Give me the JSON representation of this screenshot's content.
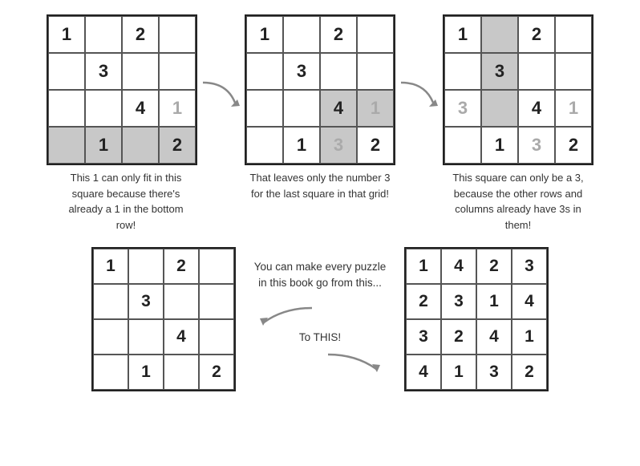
{
  "grids": {
    "top1": {
      "cells": [
        {
          "val": "1",
          "gray": false
        },
        {
          "val": "",
          "gray": false
        },
        {
          "val": "2",
          "gray": false
        },
        {
          "val": "",
          "gray": false
        },
        {
          "val": "",
          "gray": false
        },
        {
          "val": "3",
          "gray": false
        },
        {
          "val": "",
          "gray": false
        },
        {
          "val": "",
          "gray": false
        },
        {
          "val": "",
          "gray": false
        },
        {
          "val": "",
          "gray": false
        },
        {
          "val": "4",
          "gray": false
        },
        {
          "val": "1",
          "gray": false,
          "numgray": true
        },
        {
          "val": "",
          "gray": true
        },
        {
          "val": "1",
          "gray": true
        },
        {
          "val": "",
          "gray": true
        },
        {
          "val": "2",
          "gray": true
        }
      ]
    },
    "top2": {
      "cells": [
        {
          "val": "1",
          "gray": false
        },
        {
          "val": "",
          "gray": false
        },
        {
          "val": "2",
          "gray": false
        },
        {
          "val": "",
          "gray": false
        },
        {
          "val": "",
          "gray": false
        },
        {
          "val": "3",
          "gray": false
        },
        {
          "val": "",
          "gray": false
        },
        {
          "val": "",
          "gray": false
        },
        {
          "val": "",
          "gray": false
        },
        {
          "val": "",
          "gray": false
        },
        {
          "val": "4",
          "gray": true
        },
        {
          "val": "1",
          "gray": true,
          "numgray": true
        },
        {
          "val": "",
          "gray": false
        },
        {
          "val": "1",
          "gray": false
        },
        {
          "val": "3",
          "gray": true,
          "numgray": true
        },
        {
          "val": "2",
          "gray": false
        }
      ]
    },
    "top3": {
      "cells": [
        {
          "val": "1",
          "gray": false
        },
        {
          "val": "",
          "gray": true
        },
        {
          "val": "2",
          "gray": false
        },
        {
          "val": "",
          "gray": false
        },
        {
          "val": "",
          "gray": false
        },
        {
          "val": "3",
          "gray": true
        },
        {
          "val": "",
          "gray": false
        },
        {
          "val": "",
          "gray": false
        },
        {
          "val": "3",
          "gray": false,
          "numgray": true
        },
        {
          "val": "",
          "gray": true
        },
        {
          "val": "4",
          "gray": false
        },
        {
          "val": "1",
          "gray": false,
          "numgray": true
        },
        {
          "val": "",
          "gray": false
        },
        {
          "val": "1",
          "gray": false
        },
        {
          "val": "3",
          "gray": false,
          "numgray2": true
        },
        {
          "val": "2",
          "gray": false
        }
      ]
    },
    "bottom1": {
      "cells": [
        {
          "val": "1",
          "gray": false
        },
        {
          "val": "",
          "gray": false
        },
        {
          "val": "2",
          "gray": false
        },
        {
          "val": "",
          "gray": false
        },
        {
          "val": "",
          "gray": false
        },
        {
          "val": "3",
          "gray": false
        },
        {
          "val": "",
          "gray": false
        },
        {
          "val": "",
          "gray": false
        },
        {
          "val": "",
          "gray": false
        },
        {
          "val": "",
          "gray": false
        },
        {
          "val": "4",
          "gray": false
        },
        {
          "val": "",
          "gray": false
        },
        {
          "val": "",
          "gray": false
        },
        {
          "val": "1",
          "gray": false
        },
        {
          "val": "",
          "gray": false
        },
        {
          "val": "2",
          "gray": false
        }
      ]
    },
    "bottom2": {
      "cells": [
        {
          "val": "1",
          "gray": false
        },
        {
          "val": "4",
          "gray": false
        },
        {
          "val": "2",
          "gray": false
        },
        {
          "val": "3",
          "gray": false
        },
        {
          "val": "2",
          "gray": false
        },
        {
          "val": "3",
          "gray": false
        },
        {
          "val": "1",
          "gray": false
        },
        {
          "val": "4",
          "gray": false
        },
        {
          "val": "3",
          "gray": false
        },
        {
          "val": "2",
          "gray": false
        },
        {
          "val": "4",
          "gray": false
        },
        {
          "val": "1",
          "gray": false
        },
        {
          "val": "4",
          "gray": false
        },
        {
          "val": "1",
          "gray": false
        },
        {
          "val": "3",
          "gray": false
        },
        {
          "val": "2",
          "gray": false
        }
      ]
    }
  },
  "captions": {
    "top1": "This 1 can only fit in this square because there's already a 1 in the bottom row!",
    "top2": "That leaves only the number 3 for the last square in that grid!",
    "top3": "This square can only be a 3, because the other rows and columns already have 3s in them!",
    "bottom_mid_top": "You can make every puzzle in this book go from this...",
    "bottom_mid_bottom": "To THIS!"
  }
}
